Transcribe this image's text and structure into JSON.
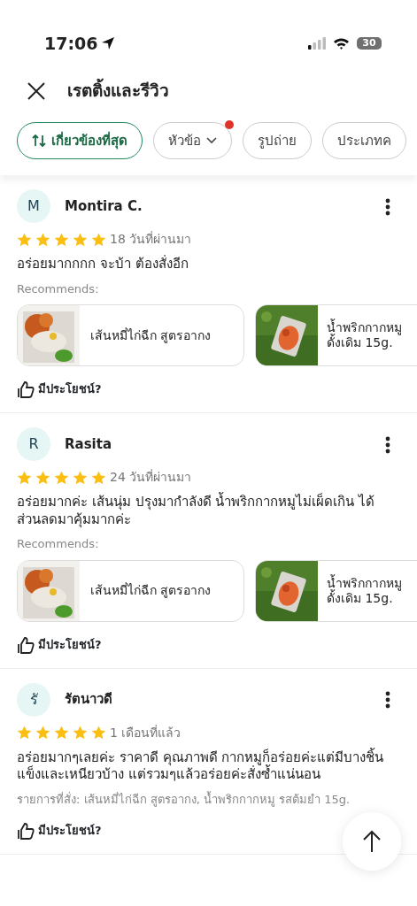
{
  "status_bar": {
    "time": "17:06",
    "battery": "30"
  },
  "header": {
    "title": "เรตติ้งและรีวิว"
  },
  "filters": [
    {
      "label": "เกี่ยวข้องที่สุด",
      "kind": "sort",
      "selected": true,
      "dot": false
    },
    {
      "label": "หัวข้อ",
      "kind": "dropdown",
      "selected": false,
      "dot": true
    },
    {
      "label": "รูปถ่าย",
      "kind": "plain",
      "selected": false,
      "dot": false
    },
    {
      "label": "ประเภทค",
      "kind": "plain",
      "selected": false,
      "dot": false
    }
  ],
  "reviews": [
    {
      "initial": "M",
      "name": "Montira C.",
      "stars": 5,
      "date": "18 วันที่ผ่านมา",
      "text": "อร่อยมากกกก จะบ้า ต้องสั่งอีก",
      "recommends_label": "Recommends:",
      "products": [
        {
          "name": "เส้นหมี่ไก่ฉีก สูตรอากง",
          "kind": "picture"
        },
        {
          "name": "น้ำพริกกากหมู ดั้งเดิม 15g.",
          "kind": "picture"
        }
      ],
      "helpful": "มีประโยชน์?"
    },
    {
      "initial": "R",
      "name": "Rasita",
      "stars": 5,
      "date": "24 วันที่ผ่านมา",
      "text": "อร่อยมากค่ะ เส้นนุ่ม ปรุงมากำลังดี น้ำพริกกากหมูไม่เผ็ดเกิน ได้ส่วนลดมาคุ้มมากค่ะ",
      "recommends_label": "Recommends:",
      "products": [
        {
          "name": "เส้นหมี่ไก่ฉีก สูตรอากง",
          "kind": "picture"
        },
        {
          "name": "น้ำพริกกากหมู ดั้งเดิม 15g.",
          "kind": "picture"
        }
      ],
      "helpful": "มีประโยชน์?"
    },
    {
      "initial": "รั",
      "name": "รัตนาวดี",
      "stars": 5,
      "date": "1 เดือนที่แล้ว",
      "text": "อร่อยมากๆเลยค่ะ ราคาดี คุณภาพดี กากหมูก็อร่อยค่ะแต่มีบางชิ้น แข็งและเหนียวบ้าง แต่รวมๆแล้วอร่อยค่ะสั่งซ้ำแน่นอน",
      "ordered": "รายการที่สั่ง: เส้นหมี่ไก่ฉีก สูตรอากง, น้ำพริกกากหมู รสต้มยำ 15g.",
      "helpful": "มีประโยชน์?"
    }
  ]
}
